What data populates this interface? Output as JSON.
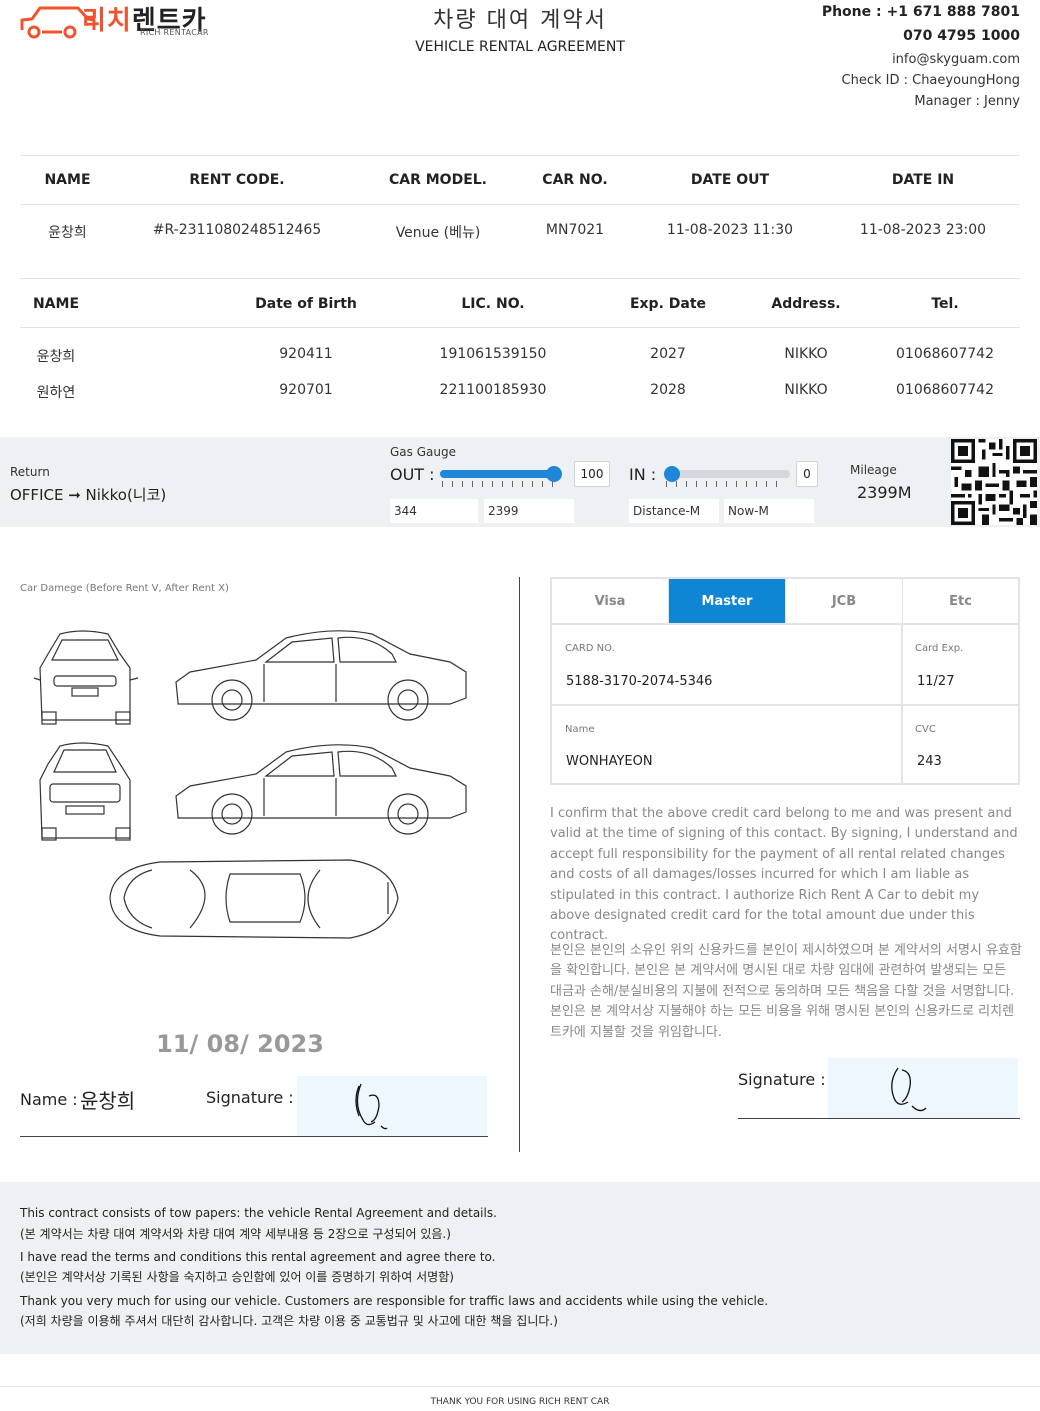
{
  "header": {
    "logo_ko_a": "리치",
    "logo_ko_b": "렌트카",
    "logo_en": "RICH RENTACAR",
    "title_ko": "차량 대여 계약서",
    "title_en": "VEHICLE RENTAL AGREEMENT",
    "phone": "Phone : +1 671 888 7801",
    "phone2": "070 4795 1000",
    "email": "info@skyguam.com",
    "check_id": "Check ID : ChaeyoungHong",
    "manager": "Manager : Jenny"
  },
  "rental": {
    "headers": [
      "NAME",
      "RENT CODE.",
      "CAR MODEL.",
      "CAR NO.",
      "DATE OUT",
      "DATE IN"
    ],
    "row": [
      "윤창희",
      "#R-2311080248512465",
      "Venue (베뉴)",
      "MN7021",
      "11-08-2023 11:30",
      "11-08-2023 23:00"
    ]
  },
  "drivers": {
    "headers": [
      "NAME",
      "Date of Birth",
      "LIC. NO.",
      "Exp. Date",
      "Address.",
      "Tel."
    ],
    "rows": [
      [
        "윤창희",
        "920411",
        "191061539150",
        "2027",
        "NIKKO",
        "01068607742"
      ],
      [
        "원하연",
        "920701",
        "221100185930",
        "2028",
        "NIKKO",
        "01068607742"
      ]
    ]
  },
  "gauge": {
    "return_label": "Return",
    "return_value": "OFFICE ➞ Nikko(니코)",
    "gas_label": "Gas Gauge",
    "out_label": "OUT :",
    "out_value": "100",
    "out_level": 1.0,
    "in_label": "IN :",
    "in_value": "0",
    "in_level": 0.0,
    "box1": "344",
    "box2": "2399",
    "box3": "Distance-M",
    "box4": "Now-M",
    "mileage_label": "Mileage",
    "mileage_value": "2399M"
  },
  "damage": {
    "title": "Car Damege (Before Rent V, After Rent X)",
    "date": "11/ 08/ 2023",
    "name_label": "Name :",
    "name_value": "윤창희",
    "signature_label": "Signature :"
  },
  "card": {
    "tabs": [
      "Visa",
      "Master",
      "JCB",
      "Etc"
    ],
    "active_tab": "Master",
    "no_label": "CARD NO.",
    "no_value": "5188-3170-2074-5346",
    "exp_label": "Card Exp.",
    "exp_value": "11/27",
    "name_label": "Name",
    "name_value": "WONHAYEON",
    "cvc_label": "CVC",
    "cvc_value": "243",
    "consent_en": "I confirm that the above credit card belong to me and was present and valid at the time of signing of this contact. By signing, I understand and accept full responsibility for the payment of all rental related changes and costs of all damages/losses incurred for which I am liable as stipulated in this contract. I authorize Rich Rent A Car to debit my above designated credit card for the total amount due under this contract.",
    "consent_ko": "본인은 본인의 소유인 위의 신용카드를 본인이 제시하였으며 본 계약서의 서명시 유효함을 확인합니다. 본인은 본 계약서에 명시된 대로 차량 임대에 관련하여 발생되는 모든 대금과 손해/분실비용의 지불에 전적으로 동의하며 모든 책음을 다할 것을 서명합니다. 본인은 본 계약서상 지불해야 하는 모든 비용을 위해 명시된 본인의 신용카드로 리치렌트카에 지불할 것을 위임합니다.",
    "signature_label": "Signature :"
  },
  "footer": {
    "lines": [
      "This contract consists of tow papers: the vehicle Rental Agreement and details.",
      "(본 계약서는 차량 대여 계약서와 차량 대여 계약 세부내용 등 2장으로 구성되어 있음.)",
      "I have read the terms and conditions this rental agreement and agree there to.",
      "(본인은 계약서상 기록된 사항을 숙지하고 승인함에 있어 이를 증명하기 위하여 서명함)",
      "Thank you very much for using our vehicle. Customers are responsible for traffic laws and accidents while using the vehicle.",
      "(저희 차량을 이용해 주셔서 대단히 감사합니다. 고객은 차량 이용 중 교통법규 및 사고에 대한 책을 집니다.)"
    ],
    "thanks": "THANK YOU FOR USING RICH RENT CAR"
  },
  "colors": {
    "brand_orange": "#f0542d",
    "accent_blue": "#0e86d4",
    "band_gray": "#eef1f4"
  }
}
